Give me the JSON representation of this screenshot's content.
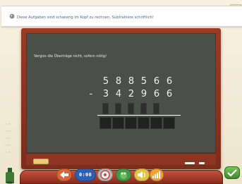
{
  "instruction": {
    "text": "Diese Aufgaben sind schwierig im Kopf zu rechnen. Subtrahiere schriftlich!"
  },
  "board": {
    "hint": "Vergiss die Überträge nicht, sofern nötig!",
    "minuend": [
      "5",
      "8",
      "8",
      "5",
      "6",
      "6"
    ],
    "operator": "-",
    "subtrahend": [
      "3",
      "4",
      "2",
      "9",
      "6",
      "6"
    ],
    "answer_boxes": 6,
    "carry_boxes": 5
  },
  "toolbar": {
    "clock": "0:00",
    "ok_icon": "checkmark-icon"
  },
  "colors": {
    "board": "#4a4f4a",
    "frame": "#8e3422",
    "banner_text": "#3b6aa0",
    "ok": "#5aa83c"
  }
}
